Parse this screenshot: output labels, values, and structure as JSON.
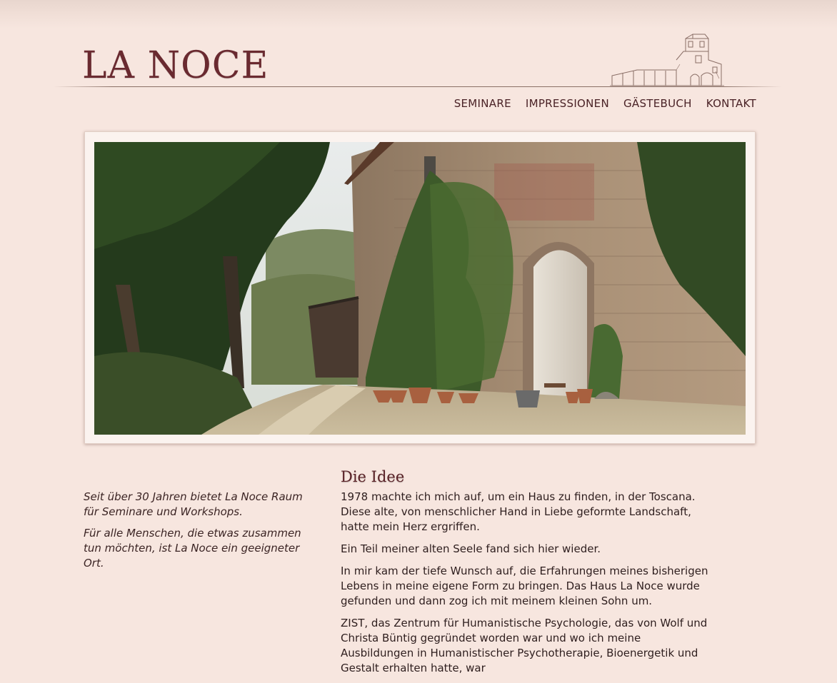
{
  "site": {
    "logo": "LA NOCE"
  },
  "nav": {
    "items": [
      "SEMINARE",
      "IMPRESSIONEN",
      "GÄSTEBUCH",
      "KONTAKT"
    ]
  },
  "hero": {
    "image": "tuscan-stone-farmhouse-photo"
  },
  "sidebar": {
    "paragraphs": [
      "Seit über 30 Jahren bietet La Noce Raum für Seminare und Workshops.",
      "Für alle Menschen, die etwas zusammen tun möchten, ist La Noce ein geeigneter Ort."
    ]
  },
  "main": {
    "title": "Die Idee",
    "paragraphs": [
      "1978 machte ich mich auf, um ein Haus zu finden, in der Toscana. Diese alte, von menschlicher Hand in Liebe geformte Landschaft, hatte mein Herz ergriffen.",
      "Ein Teil meiner alten Seele fand sich hier wieder.",
      "In mir kam der tiefe Wunsch auf, die Erfahrungen meines bisherigen Lebens in meine eigene Form zu bringen. Das Haus La Noce wurde gefunden und dann zog ich mit meinem kleinen Sohn um.",
      "ZIST, das Zentrum für Humanistische Psychologie, das von Wolf und Christa Büntig gegründet worden war und wo ich meine Ausbildungen in Humanistischer Psychotherapie, Bioenergetik und Gestalt erhalten hatte, war"
    ]
  },
  "colors": {
    "background": "#f7e6df",
    "logo": "#6a2a30",
    "heading": "#5b2328"
  }
}
